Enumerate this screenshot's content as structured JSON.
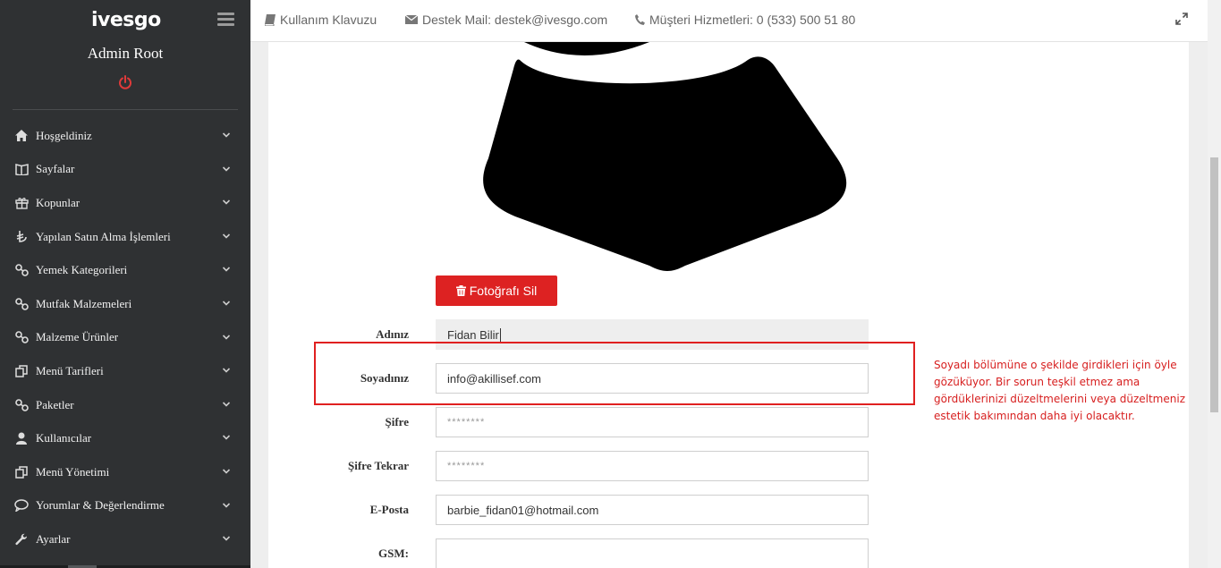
{
  "brand": {
    "logo": "ivesgo"
  },
  "sidebar": {
    "admin_name": "Admin Root",
    "items": [
      {
        "label": "Hoşgeldiniz",
        "icon": "home-icon"
      },
      {
        "label": "Sayfalar",
        "icon": "book-icon"
      },
      {
        "label": "Kopunlar",
        "icon": "gift-icon"
      },
      {
        "label": "Yapılan Satın Alma İşlemleri",
        "icon": "lira-icon"
      },
      {
        "label": "Yemek Kategorileri",
        "icon": "link-icon"
      },
      {
        "label": "Mutfak Malzemeleri",
        "icon": "link-icon"
      },
      {
        "label": "Malzeme Ürünler",
        "icon": "link-icon"
      },
      {
        "label": "Menü Tarifleri",
        "icon": "copy-icon"
      },
      {
        "label": "Paketler",
        "icon": "link-icon"
      },
      {
        "label": "Kullanıcılar",
        "icon": "user-icon"
      },
      {
        "label": "Menü Yönetimi",
        "icon": "copy-icon"
      },
      {
        "label": "Yorumlar & Değerlendirme",
        "icon": "comment-icon"
      },
      {
        "label": "Ayarlar",
        "icon": "wrench-icon"
      }
    ]
  },
  "topbar": {
    "guide": "Kullanım Klavuzu",
    "support": "Destek Mail: destek@ivesgo.com",
    "customer": "Müşteri Hizmetleri: 0 (533) 500 51 80"
  },
  "profile": {
    "delete_photo": "Fotoğrafı Sil",
    "fields": {
      "first_name": {
        "label": "Adınız",
        "value": "Fidan Bilir"
      },
      "last_name": {
        "label": "Soyadınız",
        "value": "info@akillisef.com"
      },
      "password": {
        "label": "Şifre",
        "value": "********"
      },
      "password_repeat": {
        "label": "Şifre Tekrar",
        "value": "********"
      },
      "email": {
        "label": "E-Posta",
        "value": "barbie_fidan01@hotmail.com"
      },
      "gsm": {
        "label": "GSM:",
        "value": ""
      }
    }
  },
  "annotation": {
    "text": "Soyadı bölümüne o şekilde girdikleri için öyle gözüküyor. Bir sorun teşkil etmez ama gördüklerinizi düzeltmelerini veya düzeltmeniz estetik bakımından daha iyi olacaktır."
  },
  "colors": {
    "sidebar": "#2f3133",
    "accent": "#dd2222",
    "annotation": "#e02020"
  }
}
